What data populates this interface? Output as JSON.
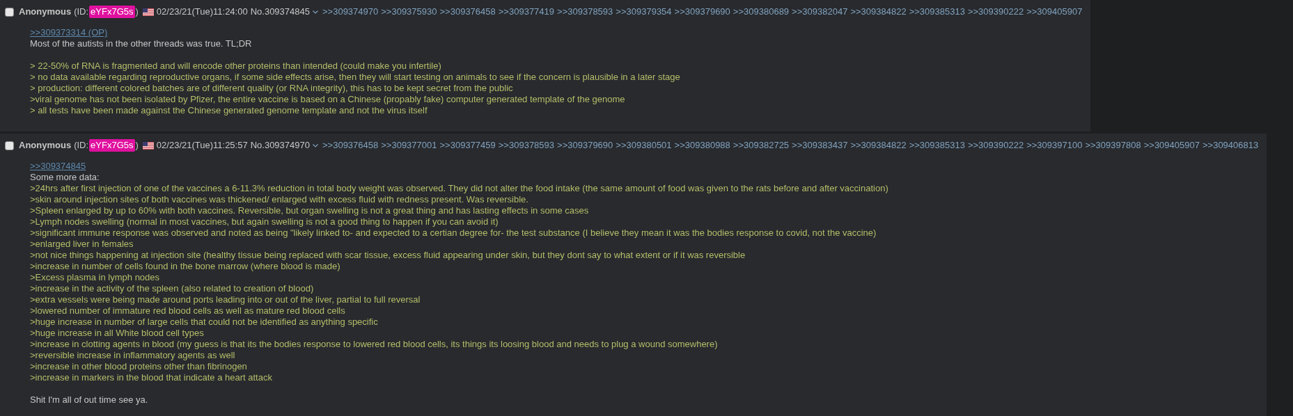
{
  "posts": [
    {
      "checked": false,
      "name": "Anonymous",
      "id_open": "(ID:",
      "poster_id": "eYFx7G5s",
      "id_close": ")",
      "date": "02/23/21(Tue)11:24:00",
      "number": "No.309374845",
      "backlinks": [
        ">>309374970",
        ">>309375930",
        ">>309376458",
        ">>309377419",
        ">>309378593",
        ">>309379354",
        ">>309379690",
        ">>309380689",
        ">>309382047",
        ">>309384822",
        ">>309385313",
        ">>309390222",
        ">>309405907"
      ],
      "lines": [
        {
          "kind": "quotelink",
          "text": ">>309373314 (OP)"
        },
        {
          "kind": "text",
          "text": "Most of the autists in the other threads was true. TL;DR"
        },
        {
          "kind": "blank"
        },
        {
          "kind": "greentext",
          "text": "> 22-50% of RNA is fragmented and will encode other proteins than intended (could make you infertile)"
        },
        {
          "kind": "greentext",
          "text": "> no data available regarding reproductive organs, if some side effects arise, then they will start testing on animals to see if the concern is plausible in a later stage"
        },
        {
          "kind": "greentext",
          "text": "> production: different colored batches are of different quality (or RNA integrity), this has to be kept secret from the public"
        },
        {
          "kind": "greentext",
          "text": ">viral genome has not been isolated by Pfizer, the entire vaccine is based on a Chinese (propably fake) computer generated template of the genome"
        },
        {
          "kind": "greentext",
          "text": "> all tests have been made against the Chinese generated genome template and not the virus itself"
        }
      ]
    },
    {
      "checked": false,
      "name": "Anonymous",
      "id_open": "(ID:",
      "poster_id": "eYFx7G5s",
      "id_close": ")",
      "date": "02/23/21(Tue)11:25:57",
      "number": "No.309374970",
      "backlinks": [
        ">>309376458",
        ">>309377001",
        ">>309377459",
        ">>309378593",
        ">>309379690",
        ">>309380501",
        ">>309380988",
        ">>309382725",
        ">>309383437",
        ">>309384822",
        ">>309385313",
        ">>309390222",
        ">>309397100",
        ">>309397808",
        ">>309405907",
        ">>309406813"
      ],
      "lines": [
        {
          "kind": "quotelink",
          "text": ">>309374845"
        },
        {
          "kind": "text",
          "text": "Some more data:"
        },
        {
          "kind": "greentext",
          "text": ">24hrs after first injection of one of the vaccines a 6-11.3% reduction in total body weight was observed. They did not alter the food intake (the same amount of food was given to the rats before and after vaccination)"
        },
        {
          "kind": "greentext",
          "text": ">skin around injection sites of both vaccines was thickened/ enlarged with excess fluid with redness present. Was reversible."
        },
        {
          "kind": "greentext",
          "text": ">Spleen enlarged by up to 60% with both vaccines. Reversible, but organ swelling is not a great thing and has lasting effects in some cases"
        },
        {
          "kind": "greentext",
          "text": ">Lymph nodes swelling (normal in most vaccines, but again swelling is not a good thing to happen if you can avoid it)"
        },
        {
          "kind": "greentext",
          "text": ">significant immune response was observed and noted as being \"likely linked to- and expected to a certian degree for- the test substance (I believe they mean it was the bodies response to covid, not the vaccine)"
        },
        {
          "kind": "greentext",
          "text": ">enlarged liver in females"
        },
        {
          "kind": "greentext",
          "text": ">not nice things happening at injection site (healthy tissue being replaced with scar tissue, excess fluid appearing under skin, but they dont say to what extent or if it was reversible"
        },
        {
          "kind": "greentext",
          "text": ">increase in number of cells found in the bone marrow (where blood is made)"
        },
        {
          "kind": "greentext",
          "text": ">Excess plasma in lymph nodes"
        },
        {
          "kind": "greentext",
          "text": ">increase in the activity of the spleen (also related to creation of blood)"
        },
        {
          "kind": "greentext",
          "text": ">extra vessels were being made around ports leading into or out of the liver, partial to full reversal"
        },
        {
          "kind": "greentext",
          "text": ">lowered number of immature red blood cells as well as mature red blood cells"
        },
        {
          "kind": "greentext",
          "text": ">huge increase in number of large cells that could not be identified as anything specific"
        },
        {
          "kind": "greentext",
          "text": ">huge increase in all White blood cell types"
        },
        {
          "kind": "greentext",
          "text": ">increase in clotting agents in blood (my guess is that its the bodies response to lowered red blood cells, its things its loosing blood and needs to plug a wound somewhere)"
        },
        {
          "kind": "greentext",
          "text": ">reversible increase in inflammatory agents as well"
        },
        {
          "kind": "greentext",
          "text": ">increase in other blood proteins other than fibrinogen"
        },
        {
          "kind": "greentext",
          "text": ">increase in markers in the blood that indicate a heart attack"
        },
        {
          "kind": "blank"
        },
        {
          "kind": "text",
          "text": "Shit I'm all of out time see ya."
        }
      ]
    }
  ]
}
